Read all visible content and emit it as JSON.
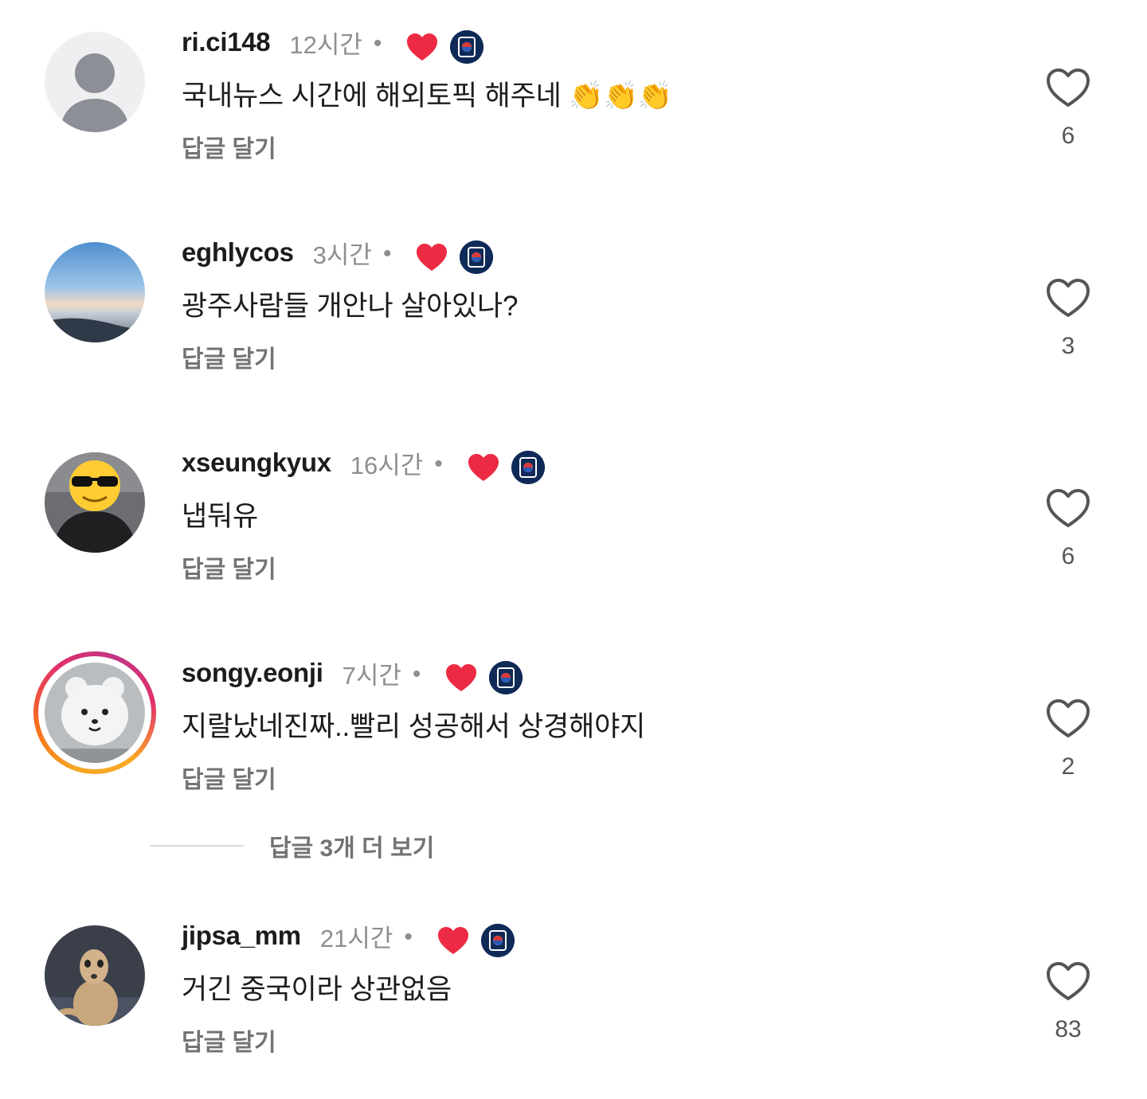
{
  "comments": [
    {
      "username": "ri.ci148",
      "time": "12시간",
      "dot": "•",
      "text": "국내뉴스 시간에 해외토픽 해주네 👏👏👏",
      "reply_label": "답글 달기",
      "likes": "6",
      "avatar": "default-person-icon"
    },
    {
      "username": "eghlycos",
      "time": "3시간",
      "dot": "•",
      "text": "광주사람들 개안나 살아있나?",
      "reply_label": "답글 달기",
      "likes": "3",
      "avatar": "sky-landscape-photo"
    },
    {
      "username": "xseungkyux",
      "time": "16시간",
      "dot": "•",
      "text": "냅둬유",
      "reply_label": "답글 달기",
      "likes": "6",
      "avatar": "sunglasses-emoji-person-photo"
    },
    {
      "username": "songy.eonji",
      "time": "7시간",
      "dot": "•",
      "text": "지랄났네진짜..빨리 성공해서 상경해야지",
      "reply_label": "답글 달기",
      "likes": "2",
      "avatar": "white-bear-figure-photo"
    },
    {
      "username": "jipsa_mm",
      "time": "21시간",
      "dot": "•",
      "text": "거긴 중국이라 상관없음",
      "reply_label": "답글 달기",
      "likes": "83",
      "avatar": "meerkat-photo"
    }
  ],
  "more_replies_label": "답글 3개 더 보기",
  "colors": {
    "liked_heart": "#ed2a43",
    "badge_bg": "#0f2a57",
    "secondary_text": "#8e8e8e",
    "reply_text": "#737373"
  },
  "icons": {
    "liked": "red-heart-icon",
    "badge": "government-emblem-badge-icon",
    "like": "heart-outline-icon"
  }
}
